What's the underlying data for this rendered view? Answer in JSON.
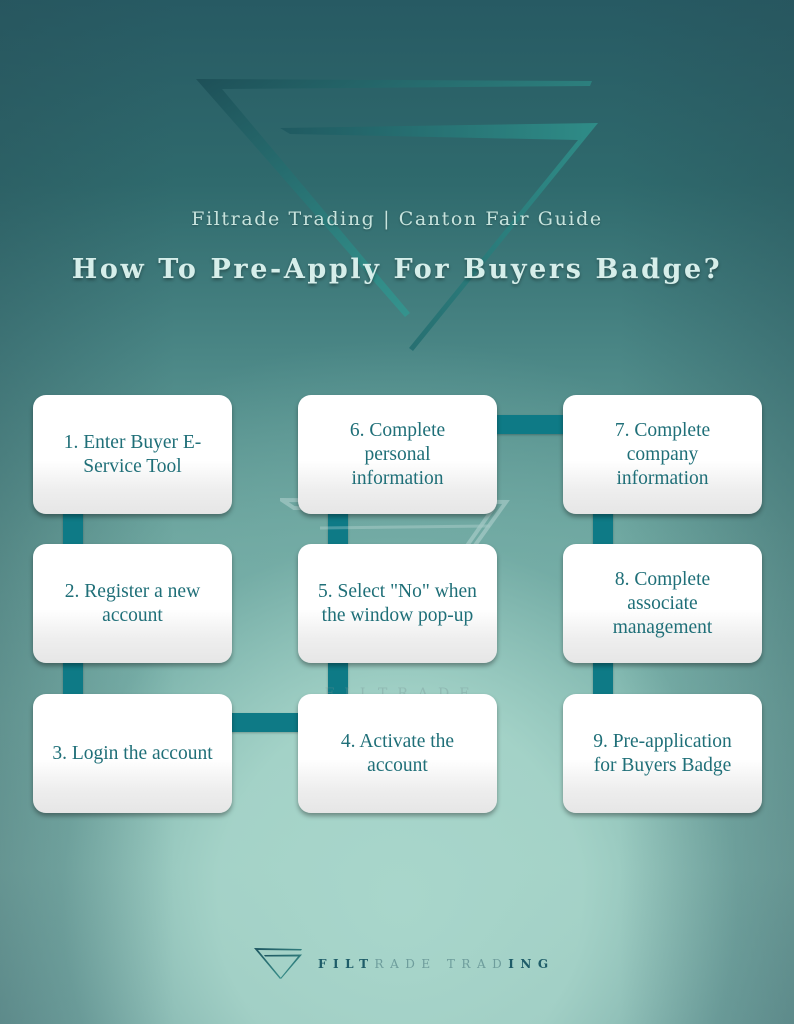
{
  "header": {
    "subtitle": "Filtrade Trading | Canton Fair Guide",
    "title": "How To Pre-Apply For Buyers Badge?"
  },
  "steps": [
    {
      "number": 1,
      "label": "1. Enter Buyer E-\nService Tool"
    },
    {
      "number": 2,
      "label": "2. Register a new\naccount"
    },
    {
      "number": 3,
      "label": "3. Login the account"
    },
    {
      "number": 4,
      "label": "4. Activate the\naccount"
    },
    {
      "number": 5,
      "label": "5. Select \"No\" when\nthe window pop-up"
    },
    {
      "number": 6,
      "label": "6. Complete\npersonal\ninformation"
    },
    {
      "number": 7,
      "label": "7. Complete\ncompany\ninformation"
    },
    {
      "number": 8,
      "label": "8. Complete\nassociate\nmanagement"
    },
    {
      "number": 9,
      "label": "9. Pre-application\nfor Buyers Badge"
    }
  ],
  "flow": [
    "1→2",
    "2→3",
    "3→4",
    "4→5",
    "5→6",
    "6→7",
    "7→8",
    "8→9"
  ],
  "watermark": {
    "text": "FILTRADE TRADING"
  },
  "footer": {
    "brand_part1": "FILT",
    "brand_part2": "RADE TRAD",
    "brand_part3": "ING"
  },
  "colors": {
    "connector": "#0e7a86",
    "card_text": "#1f6f78",
    "title_text": "#d6eeea"
  }
}
